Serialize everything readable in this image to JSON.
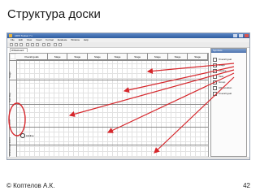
{
  "slide": {
    "title": "Структура доски",
    "author": "© Коптелов А.К.",
    "page_number": "42"
  },
  "app": {
    "window_title": "ARIS Toolset 7.x",
    "menu": [
      "File",
      "Edit",
      "View",
      "Insert",
      "Format",
      "Evaluate",
      "Window",
      "Help"
    ],
    "document_tab": "Whiteboard"
  },
  "board": {
    "stages": [
      "Overall goals",
      "Stage",
      "Stage",
      "Stage",
      "Stage",
      "Stage",
      "Stage",
      "Stage",
      "Stage"
    ],
    "swimlanes": [
      "Stage",
      "Sub Way",
      "Actor",
      "Extra",
      "Whiteboard"
    ],
    "lifeline_label": "Lifeline"
  },
  "palette": {
    "title": "Symbols",
    "items": [
      "Overall goal",
      "Stage",
      "Lifeline",
      "Task",
      "Group",
      "URI position",
      "Overall goal"
    ]
  },
  "colors": {
    "annotation": "#d6262b",
    "title_bar": "#2f5c9e"
  },
  "icons": {
    "window_controls": [
      "minimize-icon",
      "maximize-icon",
      "close-icon"
    ],
    "lifeline_glyph": "lifeline-icon"
  }
}
